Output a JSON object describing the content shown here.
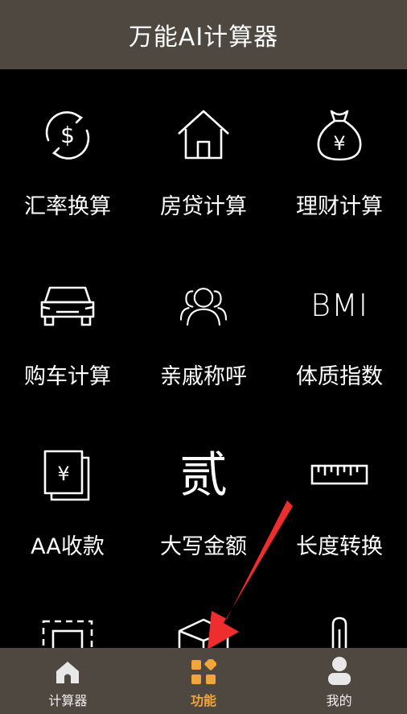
{
  "header": {
    "title": "万能AI计算器"
  },
  "grid": {
    "items": [
      {
        "label": "汇率换算"
      },
      {
        "label": "房贷计算"
      },
      {
        "label": "理财计算"
      },
      {
        "label": "购车计算"
      },
      {
        "label": "亲戚称呼"
      },
      {
        "label": "体质指数",
        "icon_text": "BMI"
      },
      {
        "label": "AA收款"
      },
      {
        "label": "大写金额",
        "icon_text": "贰"
      },
      {
        "label": "长度转换"
      }
    ]
  },
  "tabbar": {
    "items": [
      {
        "label": "计算器"
      },
      {
        "label": "功能"
      },
      {
        "label": "我的"
      }
    ]
  },
  "colors": {
    "header_bg": "#4f4841",
    "active_tab": "#f3a53a",
    "arrow": "#ee2e2e"
  }
}
